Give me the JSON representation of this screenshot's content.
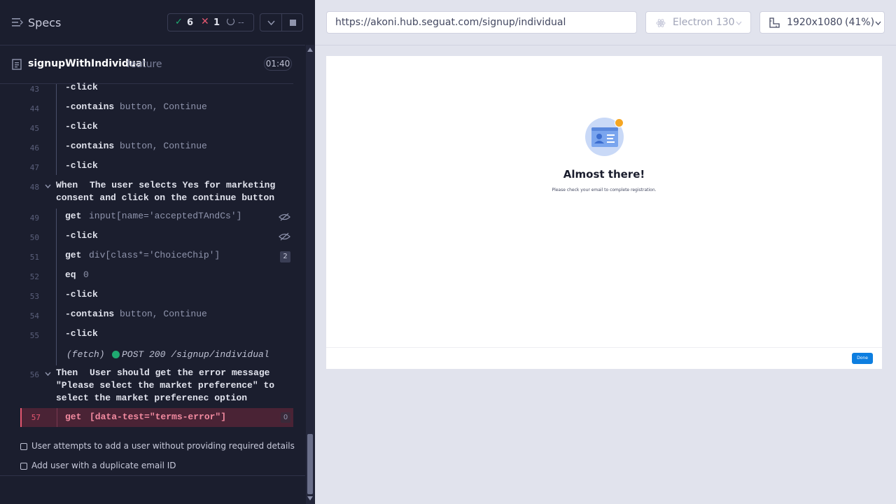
{
  "header": {
    "specs_label": "Specs",
    "passed_count": "6",
    "failed_count": "1",
    "pending_label": "--"
  },
  "spec": {
    "name": "signupWithIndividual",
    "suffix": "feature",
    "duration": "01:40"
  },
  "commands": [
    {
      "line": "43",
      "kind": "-click",
      "args": ""
    },
    {
      "line": "44",
      "kind": "-contains",
      "args": "button, Continue"
    },
    {
      "line": "45",
      "kind": "-click",
      "args": ""
    },
    {
      "line": "46",
      "kind": "-contains",
      "args": "button, Continue"
    },
    {
      "line": "47",
      "kind": "-click",
      "args": ""
    }
  ],
  "step_when": {
    "line": "48",
    "keyword": "When",
    "text_line1": "The user selects Yes for marketing",
    "text_line2": "consent and click on the continue button"
  },
  "commands2": [
    {
      "line": "49",
      "kind": "get",
      "args": "input[name='acceptedTAndCs']"
    },
    {
      "line": "50",
      "kind": "-click",
      "args": ""
    },
    {
      "line": "51",
      "kind": "get",
      "args": "div[class*='ChoiceChip']",
      "badge": "2"
    },
    {
      "line": "52",
      "kind": "eq",
      "args": "0"
    },
    {
      "line": "53",
      "kind": "-click",
      "args": ""
    },
    {
      "line": "54",
      "kind": "-contains",
      "args": "button, Continue"
    },
    {
      "line": "55",
      "kind": "-click",
      "args": ""
    }
  ],
  "fetch": {
    "label": "(fetch)",
    "text": "POST 200 /signup/individual"
  },
  "step_then": {
    "line": "56",
    "keyword": "Then",
    "text_line1": "User should get the error message",
    "text_line2": "\"Please select the market preference\" to",
    "text_line3": "select the market preferenec option"
  },
  "failed_cmd": {
    "line": "57",
    "kind": "get",
    "args": "[data-test=\"terms-error\"]",
    "badge": "0"
  },
  "tests": [
    "User attempts to add a user without providing required details",
    "Add user with a duplicate email ID"
  ],
  "browser": {
    "url": "https://akoni.hub.seguat.com/signup/individual",
    "engine": "Electron 130",
    "viewport": "1920x1080",
    "scale": "(41%)"
  },
  "app": {
    "heading": "Almost there!",
    "message": "Please check your email to complete registration.",
    "done_label": "Done"
  },
  "colors": {
    "pass": "#1fa971",
    "fail": "#e45770",
    "accent": "#0d7ee0"
  }
}
